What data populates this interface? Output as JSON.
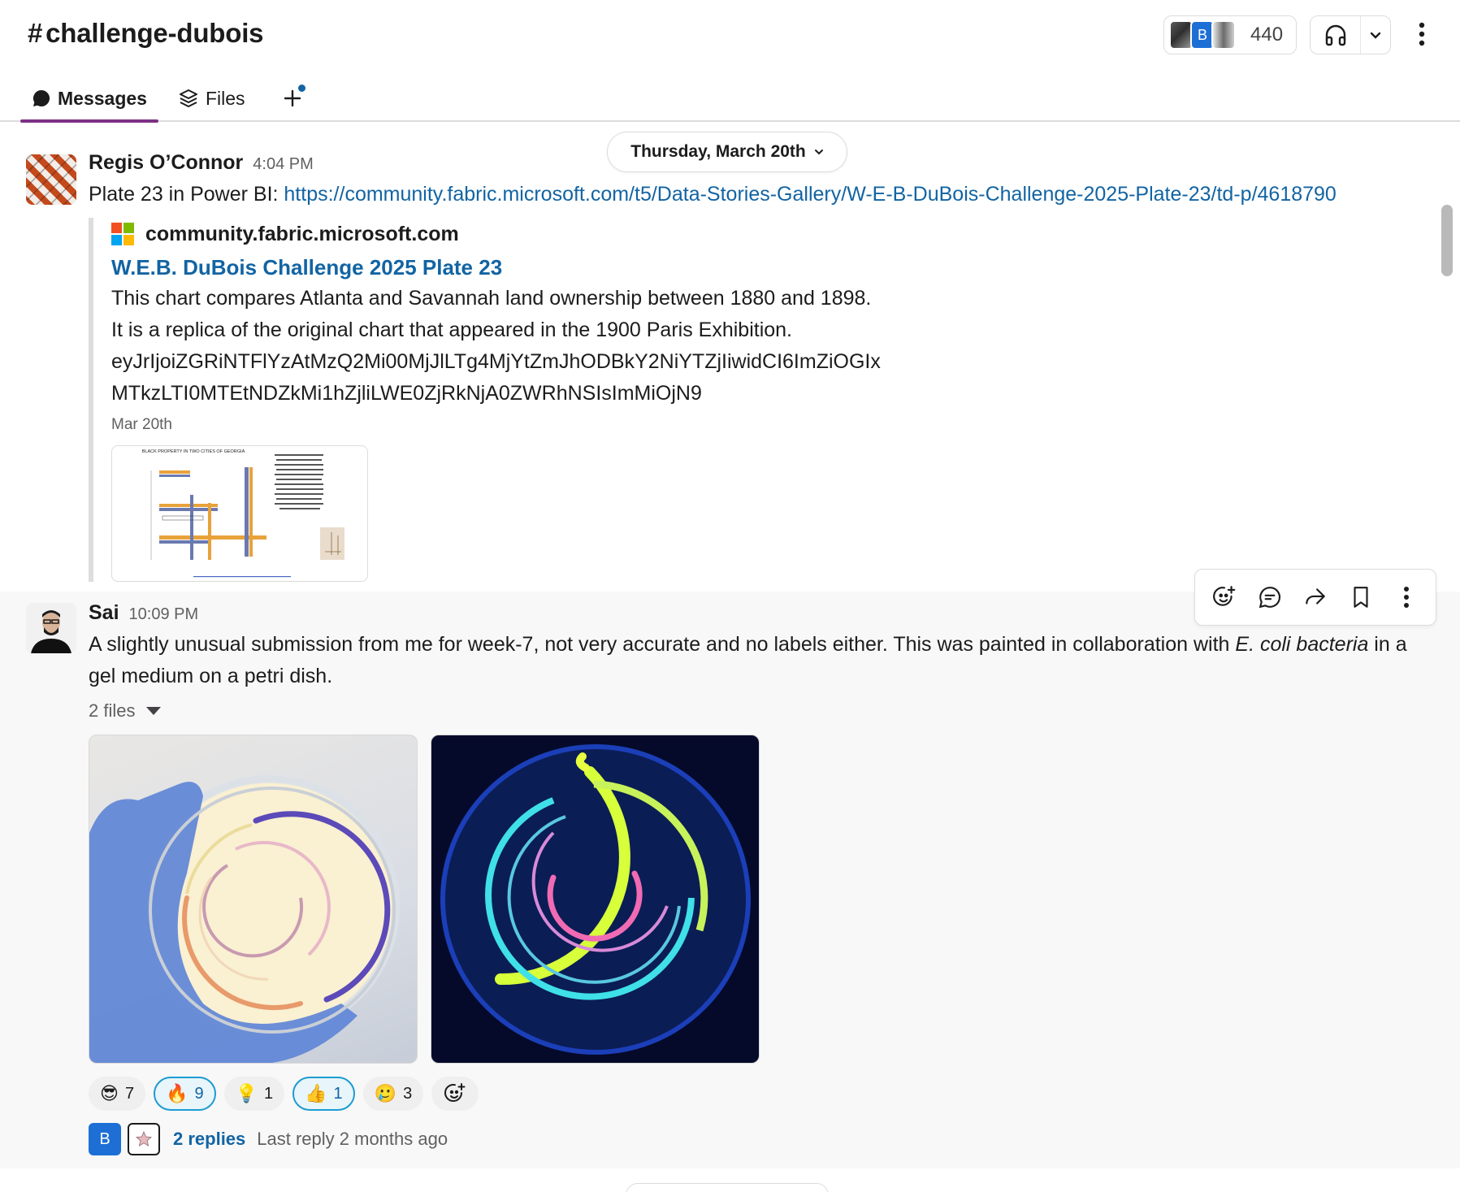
{
  "header": {
    "channel_hash": "#",
    "channel_name": "challenge-dubois",
    "member_count": "440",
    "member_avatar_initial": "B",
    "tabs": [
      {
        "label": "Messages",
        "icon": "chat-bubble-icon",
        "active": true
      },
      {
        "label": "Files",
        "icon": "layers-icon",
        "active": false
      }
    ]
  },
  "date_divider": {
    "label": "Thursday, March 20th"
  },
  "messages": [
    {
      "author": "Regis O’Connor",
      "time": "4:04 PM",
      "text_prefix": "Plate 23 in Power BI: ",
      "link": "https://community.fabric.microsoft.com/t5/Data-Stories-Gallery/W-E-B-DuBois-Challenge-2025-Plate-23/td-p/4618790",
      "unfurl": {
        "site": "community.fabric.microsoft.com",
        "title": "W.E.B. DuBois Challenge 2025 Plate 23",
        "desc_lines": [
          "This chart compares Atlanta and Savannah land ownership between 1880 and 1898.",
          "It is a replica of the original chart that appeared in the 1900 Paris Exhibition.",
          "eyJrIjoiZGRiNTFlYzAtMzQ2Mi00MjJlLTg4MjYtZmJhODBkY2NiYTZjIiwidCI6ImZiOGIx",
          "MTkzLTI0MTEtNDZkMi1hZjliLWE0ZjRkNjA0ZWRhNSIsImMiOjN9"
        ],
        "date": "Mar 20th",
        "thumb_title": "BLACK PROPERTY IN TWO CITIES OF GEORGIA"
      }
    },
    {
      "author": "Sai",
      "time": "10:09 PM",
      "text_before": "A slightly unusual submission from me for week-7, not very accurate and no labels either. This was painted in collaboration with ",
      "text_italic": "E. coli bacteria",
      "text_after": " in a gel medium on a petri dish.",
      "files_label": "2 files",
      "reactions": [
        {
          "emoji": "😎",
          "count": "7",
          "mine": false
        },
        {
          "emoji": "🔥",
          "count": "9",
          "mine": true
        },
        {
          "emoji": "💡",
          "count": "1",
          "mine": false
        },
        {
          "emoji": "👍",
          "count": "1",
          "mine": true
        },
        {
          "emoji": "🥲",
          "count": "3",
          "mine": false
        }
      ],
      "thread": {
        "avatar_initial": "B",
        "replies": "2 replies",
        "last_reply": "Last reply 2 months ago"
      }
    }
  ],
  "colors": {
    "link": "#1264a3",
    "active_tab": "#7c3085",
    "reaction_mine_border": "#1d9bd1"
  }
}
